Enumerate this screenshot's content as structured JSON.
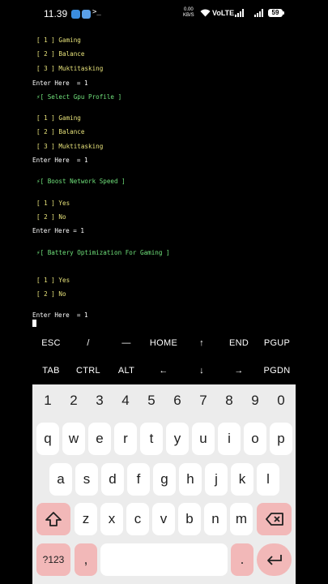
{
  "status": {
    "time": "11.39",
    "terminal_glyph": ">_",
    "speed_top": "0.00",
    "speed_bottom": "KB/S",
    "volte": "VoLTE",
    "battery": "59"
  },
  "terminal": {
    "lines": [
      {
        "text": "[ 1 ] Gaming",
        "color": "yellow",
        "indent": true
      },
      {
        "text": "[ 2 ] Balance",
        "color": "yellow",
        "indent": true
      },
      {
        "text": "[ 3 ] Muktitasking",
        "color": "yellow",
        "indent": true
      },
      {
        "text": "Enter Here  = 1",
        "color": "white",
        "indent": false
      },
      {
        "text": "⚡[ Select Gpu Profile ]",
        "color": "green",
        "indent": true
      },
      {
        "text": "[ 1 ] Gaming",
        "color": "yellow",
        "indent": true
      },
      {
        "text": "[ 2 ] Balance",
        "color": "yellow",
        "indent": true
      },
      {
        "text": "[ 3 ] Muktitasking",
        "color": "yellow",
        "indent": true
      },
      {
        "text": "Enter Here  = 1",
        "color": "white",
        "indent": false
      },
      {
        "text": "⚡[ Boost Network Speed ]",
        "color": "green",
        "indent": true
      },
      {
        "text": "[ 1 ] Yes",
        "color": "yellow",
        "indent": true
      },
      {
        "text": "[ 2 ] No",
        "color": "yellow",
        "indent": true
      },
      {
        "text": "Enter Here = 1",
        "color": "white",
        "indent": false
      },
      {
        "text": "⚡[ Battery Optimization For Gaming ]",
        "color": "green",
        "indent": true
      },
      {
        "text": "[ 1 ] Yes",
        "color": "yellow",
        "indent": true
      },
      {
        "text": "[ 2 ] No",
        "color": "yellow",
        "indent": true
      },
      {
        "text": "Enter Here  = 1",
        "color": "white",
        "indent": false
      }
    ]
  },
  "extra_keys": {
    "row1": [
      "ESC",
      "/",
      "—",
      "HOME",
      "↑",
      "END",
      "PGUP"
    ],
    "row2": [
      "TAB",
      "CTRL",
      "ALT",
      "←",
      "↓",
      "→",
      "PGDN"
    ]
  },
  "keyboard": {
    "numbers": [
      "1",
      "2",
      "3",
      "4",
      "5",
      "6",
      "7",
      "8",
      "9",
      "0"
    ],
    "row_q": [
      "q",
      "w",
      "e",
      "r",
      "t",
      "y",
      "u",
      "i",
      "o",
      "p"
    ],
    "row_a": [
      "a",
      "s",
      "d",
      "f",
      "g",
      "h",
      "j",
      "k",
      "l"
    ],
    "row_z": [
      "z",
      "x",
      "c",
      "v",
      "b",
      "n",
      "m"
    ],
    "symbols_label": "?123",
    "comma": ",",
    "period": ".",
    "colors": {
      "accent": "#f2b8b8",
      "key": "#ffffff",
      "background": "#ececec"
    }
  }
}
